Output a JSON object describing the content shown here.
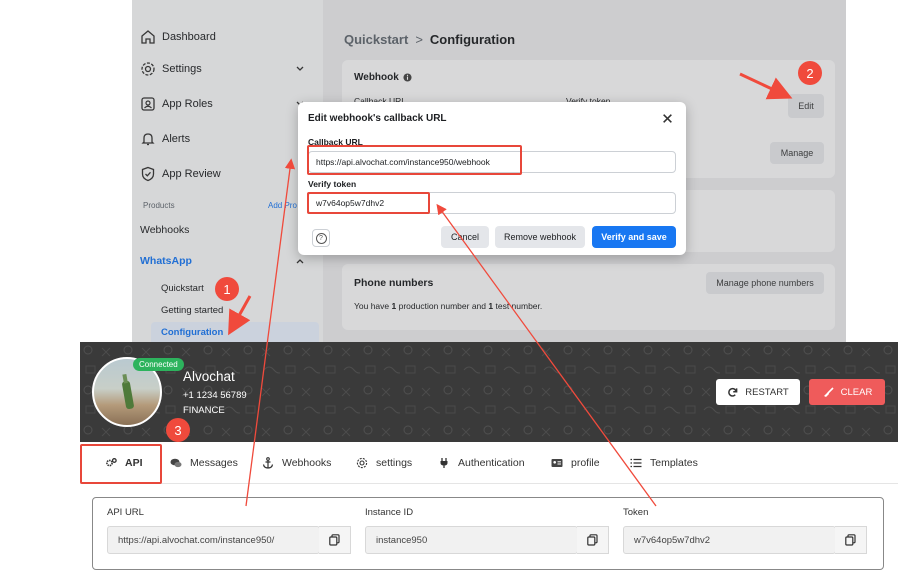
{
  "meta": {
    "sidebar": {
      "items": [
        {
          "label": "Dashboard",
          "icon": "home-icon"
        },
        {
          "label": "Settings",
          "icon": "gear-icon"
        },
        {
          "label": "App Roles",
          "icon": "roles-icon"
        },
        {
          "label": "Alerts",
          "icon": "bell-icon"
        },
        {
          "label": "App Review",
          "icon": "shield-check-icon"
        }
      ],
      "products_label": "Products",
      "add_product": "Add Pro",
      "webhooks": "Webhooks",
      "whatsapp": "WhatsApp",
      "sub": [
        "Quickstart",
        "Getting started",
        "Configuration"
      ]
    },
    "breadcrumb": {
      "parent": "Quickstart",
      "sep": ">",
      "current": "Configuration"
    },
    "webhook_card": {
      "title": "Webhook",
      "col1": "Callback URL",
      "col2": "Verify token",
      "edit": "Edit"
    },
    "manage_label": "Manage",
    "phone_card": {
      "title": "Phone numbers",
      "pre": "You have ",
      "n1": "1",
      "mid": " production number and ",
      "n2": "1",
      "post": " test number.",
      "button": "Manage phone numbers"
    },
    "modal": {
      "title": "Edit webhook's callback URL",
      "callback_label": "Callback URL",
      "callback_value": "https://api.alvochat.com/instance950/webhook",
      "token_label": "Verify token",
      "token_value": "w7v64op5w7dhv2",
      "help": "?",
      "cancel": "Cancel",
      "remove": "Remove webhook",
      "verify": "Verify and save"
    }
  },
  "alvochat": {
    "status": "Connected",
    "name": "Alvochat",
    "phone": "+1 1234 56789",
    "tag": "FINANCE",
    "restart": "RESTART",
    "clear": "CLEAR",
    "tabs": [
      {
        "label": "API",
        "icon": "gears-icon"
      },
      {
        "label": "Messages",
        "icon": "chat-icon"
      },
      {
        "label": "Webhooks",
        "icon": "anchor-icon"
      },
      {
        "label": "settings",
        "icon": "gear-icon"
      },
      {
        "label": "Authentication",
        "icon": "plug-icon"
      },
      {
        "label": "profile",
        "icon": "id-card-icon"
      },
      {
        "label": "Templates",
        "icon": "list-icon"
      }
    ],
    "fields": [
      {
        "label": "API URL",
        "value": "https://api.alvochat.com/instance950/"
      },
      {
        "label": "Instance ID",
        "value": "instance950"
      },
      {
        "label": "Token",
        "value": "w7v64op5w7dhv2"
      }
    ]
  },
  "annotations": {
    "badges": [
      "1",
      "2",
      "3"
    ],
    "color": "#f04a3c"
  }
}
